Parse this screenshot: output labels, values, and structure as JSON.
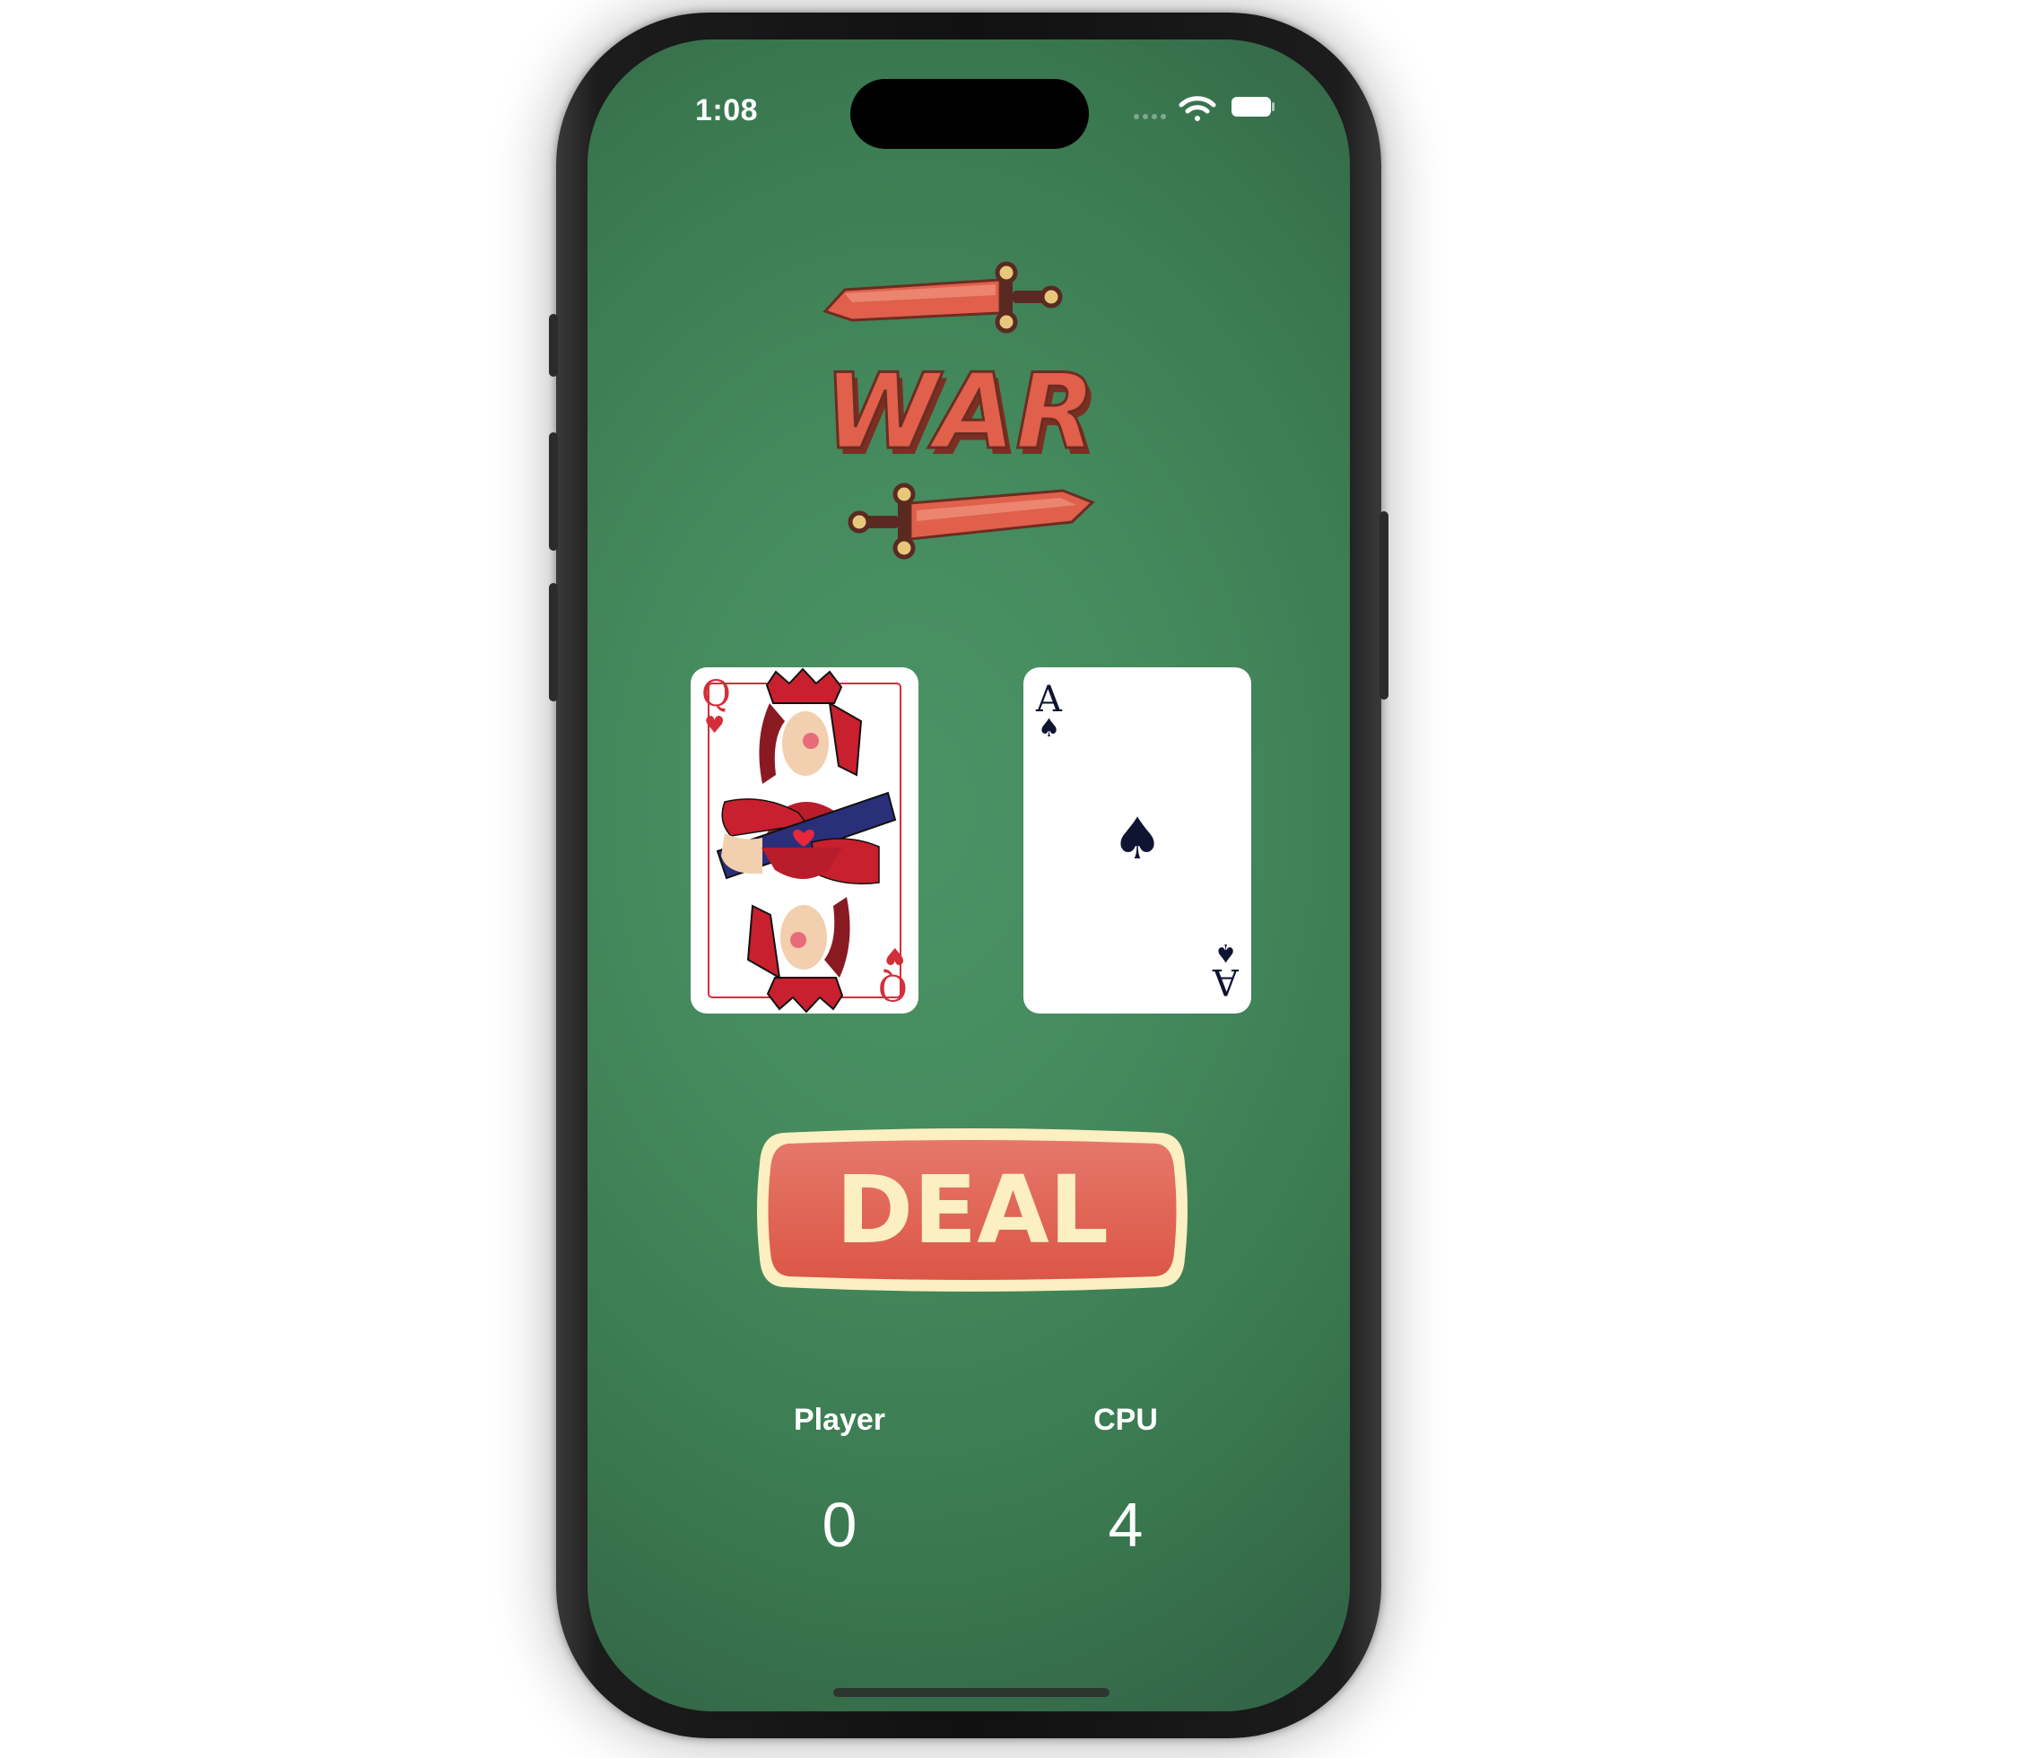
{
  "status_bar": {
    "time": "1:08",
    "icons": [
      "signal-icon",
      "wifi-icon",
      "battery-icon"
    ]
  },
  "logo": {
    "text": "WAR",
    "icons": [
      "sword-icon",
      "sword-icon"
    ]
  },
  "cards": {
    "player": {
      "rank": "Q",
      "suit": "hearts",
      "suit_symbol": "♥"
    },
    "cpu": {
      "rank": "A",
      "suit": "spades",
      "suit_symbol": "♠"
    }
  },
  "deal_button": {
    "label": "DEAL"
  },
  "scores": {
    "player_label": "Player",
    "cpu_label": "CPU",
    "player_value": "0",
    "cpu_value": "4"
  },
  "colors": {
    "table_green": "#448A5D",
    "logo_red": "#E0604C",
    "button_red": "#E05A48",
    "button_cream": "#FCEFC2",
    "heart_red": "#D32F3A",
    "spade_navy": "#0F1433"
  }
}
